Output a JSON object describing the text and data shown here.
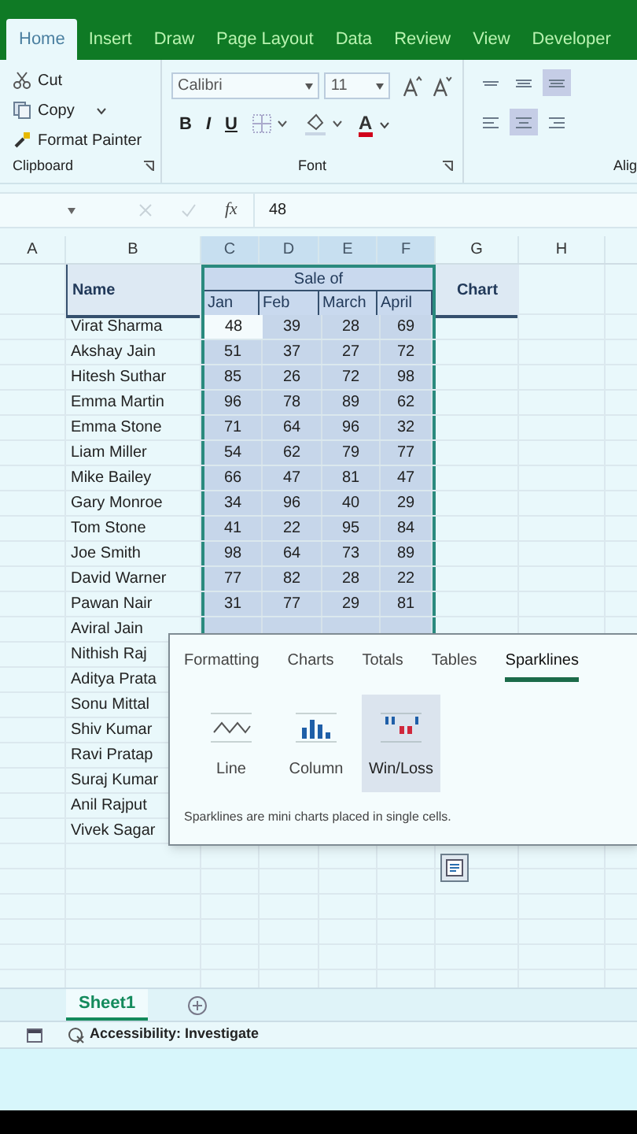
{
  "ribbon_tabs": [
    {
      "label": "Home",
      "selected": true
    },
    {
      "label": "Insert",
      "selected": false
    },
    {
      "label": "Draw",
      "selected": false
    },
    {
      "label": "Page Layout",
      "selected": false
    },
    {
      "label": "Data",
      "selected": false
    },
    {
      "label": "Review",
      "selected": false
    },
    {
      "label": "View",
      "selected": false
    },
    {
      "label": "Developer",
      "selected": false
    }
  ],
  "clipboard": {
    "group_label": "Clipboard",
    "items": [
      {
        "label": "Cut",
        "kind": "cut"
      },
      {
        "label": "Copy",
        "kind": "copy"
      },
      {
        "label": "Format Painter",
        "kind": "painter"
      }
    ]
  },
  "font": {
    "group_label": "Font",
    "font_name": "Calibri",
    "font_size": "11",
    "style_buttons": [
      "B",
      "I",
      "U"
    ],
    "font_color_letter": "A"
  },
  "alignment": {
    "group_label": "Alig",
    "buttons": [
      {
        "kind": "top",
        "selected": false
      },
      {
        "kind": "middle",
        "selected": false
      },
      {
        "kind": "bottom",
        "selected": true
      },
      {
        "kind": "left",
        "selected": false
      },
      {
        "kind": "center",
        "selected": true
      },
      {
        "kind": "right",
        "selected": false
      }
    ]
  },
  "formula_bar": {
    "function_label": "fx",
    "value": "48"
  },
  "columns": [
    {
      "label": "A",
      "selected": false
    },
    {
      "label": "B",
      "selected": false
    },
    {
      "label": "C",
      "selected": true
    },
    {
      "label": "D",
      "selected": true
    },
    {
      "label": "E",
      "selected": true
    },
    {
      "label": "F",
      "selected": true
    },
    {
      "label": "G",
      "selected": false
    },
    {
      "label": "H",
      "selected": false
    }
  ],
  "table": {
    "name_header": "Name",
    "group_header": "Sale of",
    "month_headers": [
      "Jan",
      "Feb",
      "March",
      "April"
    ],
    "chart_header": "Chart",
    "rows": [
      {
        "name": "Virat Sharma",
        "in_selection": true,
        "cells": [
          {
            "text": "48",
            "active": true
          },
          {
            "text": "39",
            "active": false
          },
          {
            "text": "28",
            "active": false
          },
          {
            "text": "69",
            "active": false
          }
        ]
      },
      {
        "name": "Akshay Jain",
        "in_selection": true,
        "cells": [
          {
            "text": "51",
            "active": false
          },
          {
            "text": "37",
            "active": false
          },
          {
            "text": "27",
            "active": false
          },
          {
            "text": "72",
            "active": false
          }
        ]
      },
      {
        "name": "Hitesh Suthar",
        "in_selection": true,
        "cells": [
          {
            "text": "85",
            "active": false
          },
          {
            "text": "26",
            "active": false
          },
          {
            "text": "72",
            "active": false
          },
          {
            "text": "98",
            "active": false
          }
        ]
      },
      {
        "name": "Emma Martin",
        "in_selection": true,
        "cells": [
          {
            "text": "96",
            "active": false
          },
          {
            "text": "78",
            "active": false
          },
          {
            "text": "89",
            "active": false
          },
          {
            "text": "62",
            "active": false
          }
        ]
      },
      {
        "name": "Emma Stone",
        "in_selection": true,
        "cells": [
          {
            "text": "71",
            "active": false
          },
          {
            "text": "64",
            "active": false
          },
          {
            "text": "96",
            "active": false
          },
          {
            "text": "32",
            "active": false
          }
        ]
      },
      {
        "name": "Liam Miller",
        "in_selection": true,
        "cells": [
          {
            "text": "54",
            "active": false
          },
          {
            "text": "62",
            "active": false
          },
          {
            "text": "79",
            "active": false
          },
          {
            "text": "77",
            "active": false
          }
        ]
      },
      {
        "name": "Mike Bailey",
        "in_selection": true,
        "cells": [
          {
            "text": "66",
            "active": false
          },
          {
            "text": "47",
            "active": false
          },
          {
            "text": "81",
            "active": false
          },
          {
            "text": "47",
            "active": false
          }
        ]
      },
      {
        "name": "Gary Monroe",
        "in_selection": true,
        "cells": [
          {
            "text": "34",
            "active": false
          },
          {
            "text": "96",
            "active": false
          },
          {
            "text": "40",
            "active": false
          },
          {
            "text": "29",
            "active": false
          }
        ]
      },
      {
        "name": "Tom Stone",
        "in_selection": true,
        "cells": [
          {
            "text": "41",
            "active": false
          },
          {
            "text": "22",
            "active": false
          },
          {
            "text": "95",
            "active": false
          },
          {
            "text": "84",
            "active": false
          }
        ]
      },
      {
        "name": "Joe Smith",
        "in_selection": true,
        "cells": [
          {
            "text": "98",
            "active": false
          },
          {
            "text": "64",
            "active": false
          },
          {
            "text": "73",
            "active": false
          },
          {
            "text": "89",
            "active": false
          }
        ]
      },
      {
        "name": "David Warner",
        "in_selection": true,
        "cells": [
          {
            "text": "77",
            "active": false
          },
          {
            "text": "82",
            "active": false
          },
          {
            "text": "28",
            "active": false
          },
          {
            "text": "22",
            "active": false
          }
        ]
      },
      {
        "name": "Pawan Nair",
        "in_selection": true,
        "cells": [
          {
            "text": "31",
            "active": false
          },
          {
            "text": "77",
            "active": false
          },
          {
            "text": "29",
            "active": false
          },
          {
            "text": "81",
            "active": false
          }
        ]
      },
      {
        "name": "Aviral Jain",
        "in_selection": true,
        "cells": []
      },
      {
        "name": "Nithish Raj",
        "cells": []
      },
      {
        "name": "Aditya Prata",
        "cells": []
      },
      {
        "name": "Sonu Mittal",
        "cells": []
      },
      {
        "name": "Shiv Kumar",
        "cells": []
      },
      {
        "name": "Ravi Pratap",
        "cells": []
      },
      {
        "name": "Suraj Kumar",
        "cells": []
      },
      {
        "name": "Anil Rajput",
        "cells": []
      },
      {
        "name": "Vivek Sagar",
        "cells": []
      }
    ]
  },
  "quick_analysis": {
    "tabs": [
      {
        "label": "Formatting",
        "selected": false
      },
      {
        "label": "Charts",
        "selected": false
      },
      {
        "label": "Totals",
        "selected": false
      },
      {
        "label": "Tables",
        "selected": false
      },
      {
        "label": "Sparklines",
        "selected": true
      }
    ],
    "options": [
      {
        "label": "Line",
        "kind": "line",
        "selected": false
      },
      {
        "label": "Column",
        "kind": "column",
        "selected": false
      },
      {
        "label": "Win/Loss",
        "kind": "winloss",
        "selected": true
      }
    ],
    "description": "Sparklines are mini charts placed in single cells."
  },
  "sheet_tabs": [
    {
      "label": "Sheet1",
      "selected": true
    }
  ],
  "status_bar": {
    "accessibility": "Accessibility: Investigate"
  }
}
